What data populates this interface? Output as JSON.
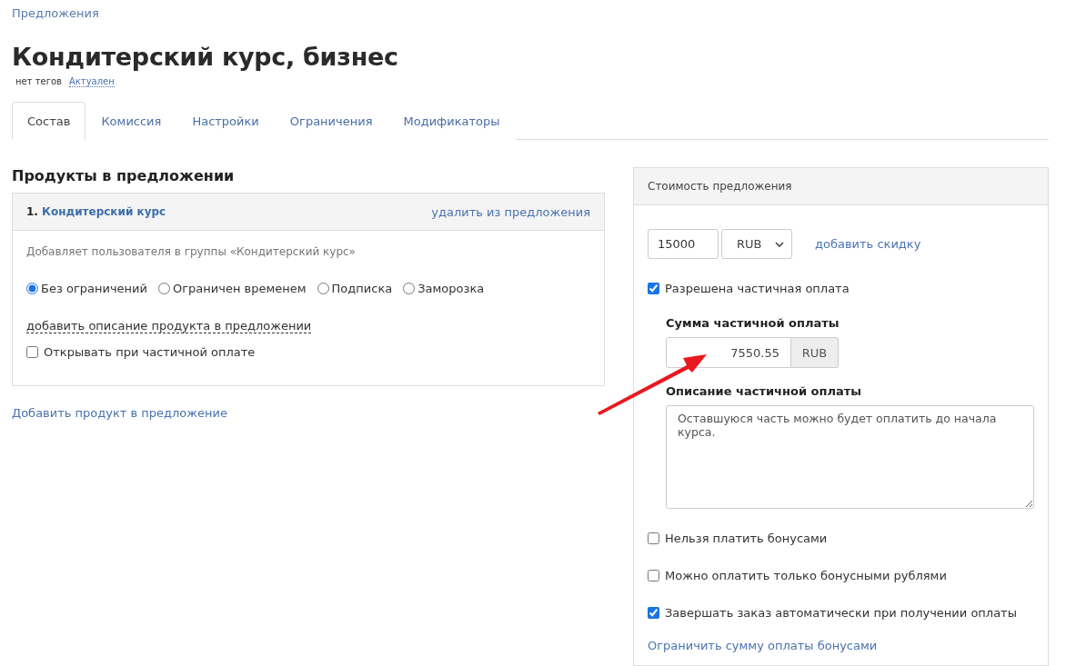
{
  "breadcrumb": "Предложения",
  "title": "Кондитерский курс, бизнес",
  "tags": {
    "label": "нет тегов",
    "status": "Актуален"
  },
  "tabs": [
    {
      "label": "Состав",
      "selected": true
    },
    {
      "label": "Комиссия",
      "selected": false
    },
    {
      "label": "Настройки",
      "selected": false
    },
    {
      "label": "Ограничения",
      "selected": false
    },
    {
      "label": "Модификаторы",
      "selected": false
    }
  ],
  "products": {
    "heading": "Продукты в предложении",
    "items": [
      {
        "number": "1.",
        "name": "Кондитерский курс",
        "remove": "удалить из предложения",
        "description": "Добавляет пользователя в группы «Кондитерский курс»",
        "access_options": [
          {
            "label": "Без ограничений",
            "selected": true
          },
          {
            "label": "Ограничен временем",
            "selected": false
          },
          {
            "label": "Подписка",
            "selected": false
          },
          {
            "label": "Заморозка",
            "selected": false
          }
        ],
        "add_description": "добавить описание продукта в предложении",
        "open_on_partial": {
          "label": "Открывать при частичной оплате",
          "checked": false
        }
      }
    ],
    "add_product": "Добавить продукт в предложение"
  },
  "price_panel": {
    "title": "Стоимость предложения",
    "price": "15000",
    "currency": "RUB",
    "add_discount": "добавить скидку",
    "partial_allowed": {
      "label": "Разрешена частичная оплата",
      "checked": true
    },
    "partial_amount_label": "Сумма частичной оплаты",
    "partial_amount": "7550.55",
    "partial_currency": "RUB",
    "partial_description_label": "Описание частичной оплаты",
    "partial_description": "Оставшуюся часть можно будет оплатить до начала курса.",
    "options": [
      {
        "label": "Нельзя платить бонусами",
        "checked": false
      },
      {
        "label": "Можно оплатить только бонусными рублями",
        "checked": false
      },
      {
        "label": "Завершать заказ автоматически при получении оплаты",
        "checked": true
      }
    ],
    "limit_bonus": "Ограничить сумму оплаты бонусами"
  }
}
